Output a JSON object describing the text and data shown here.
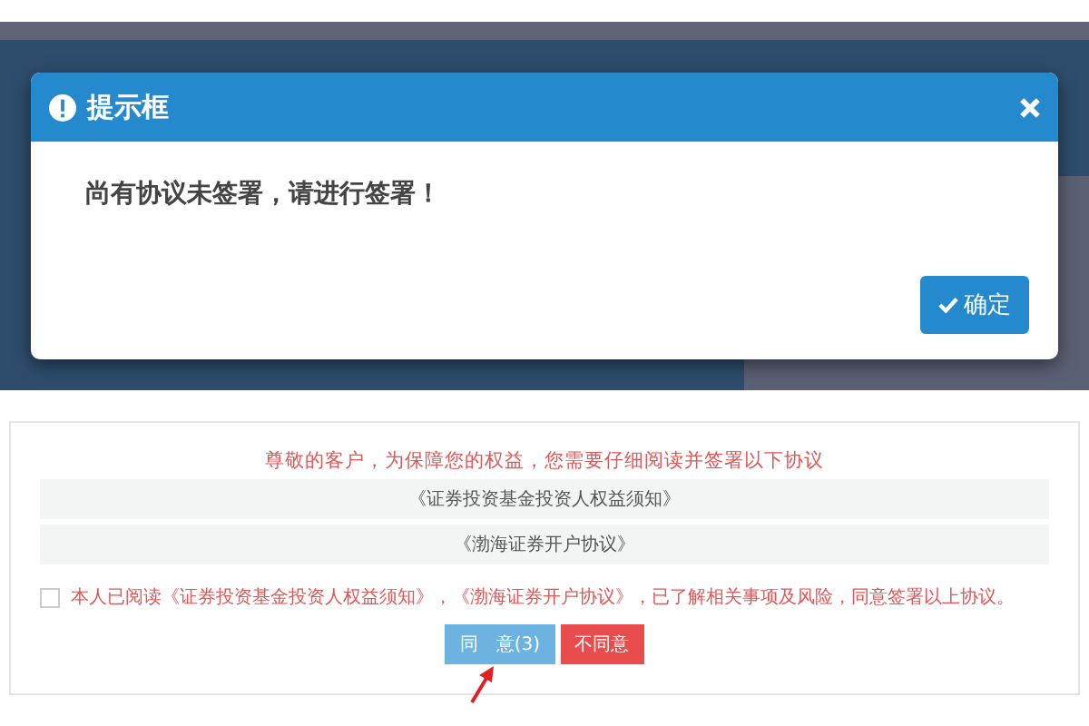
{
  "dialog": {
    "title": "提示框",
    "message": "尚有协议未签署，请进行签署！",
    "confirm_button": "确定"
  },
  "agreement_panel": {
    "notice": "尊敬的客户，为保障您的权益，您需要仔细阅读并签署以下协议",
    "documents": [
      "《证券投资基金投资人权益须知》",
      "《渤海证券开户协议》"
    ],
    "consent": {
      "checked": false,
      "text": "本人已阅读《证券投资基金投资人权益须知》，《渤海证券开户协议》，已了解相关事项及风险，同意签署以上协议。"
    },
    "buttons": [
      {
        "kind": "agree",
        "label": "同　意(3)",
        "disabled": true
      },
      {
        "kind": "disagree",
        "label": "不同意",
        "disabled": false
      }
    ]
  }
}
